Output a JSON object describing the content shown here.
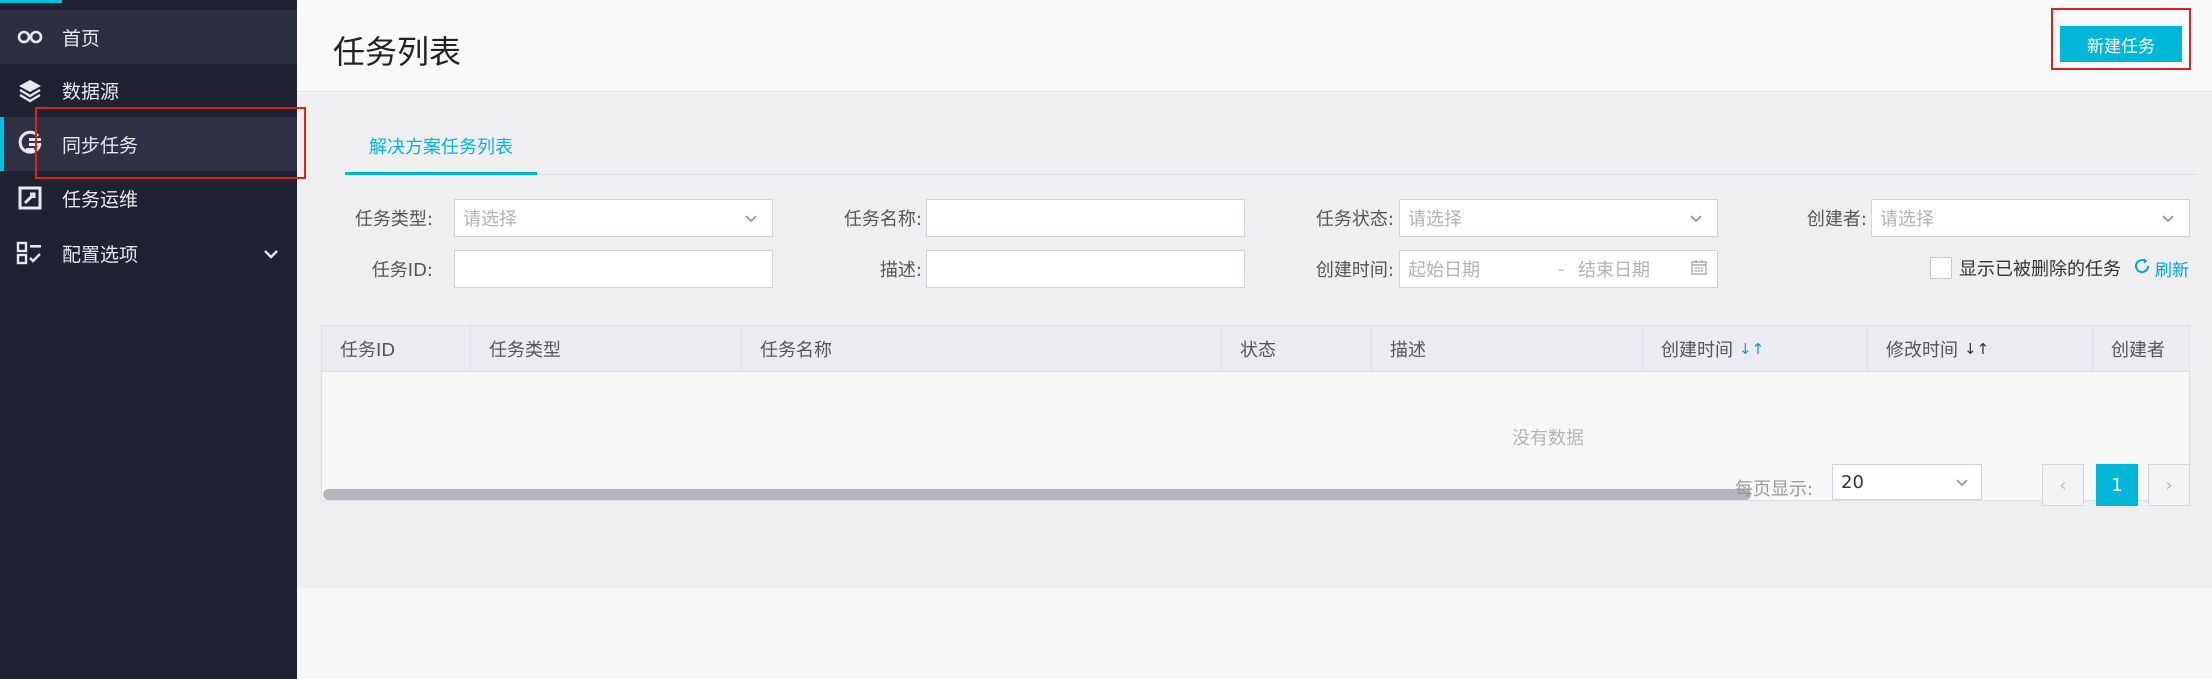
{
  "sidebar": {
    "items": [
      {
        "label": "首页",
        "icon": "infinity-icon"
      },
      {
        "label": "数据源",
        "icon": "layers-icon"
      },
      {
        "label": "同步任务",
        "icon": "sync-task-icon"
      },
      {
        "label": "任务运维",
        "icon": "wrench-box-icon"
      },
      {
        "label": "配置选项",
        "icon": "config-list-icon"
      }
    ]
  },
  "header": {
    "title": "任务列表",
    "new_task": "新建任务"
  },
  "tabs": [
    {
      "label": "解决方案任务列表"
    }
  ],
  "filters": {
    "task_type_label": "任务类型:",
    "task_type_placeholder": "请选择",
    "task_name_label": "任务名称:",
    "task_status_label": "任务状态:",
    "task_status_placeholder": "请选择",
    "creator_label": "创建者:",
    "creator_placeholder": "请选择",
    "task_id_label": "任务ID:",
    "desc_label": "描述:",
    "created_time_label": "创建时间:",
    "start_date_placeholder": "起始日期",
    "date_sep": "-",
    "end_date_placeholder": "结束日期",
    "show_deleted": "显示已被删除的任务",
    "refresh": "刷新"
  },
  "table": {
    "columns": [
      "任务ID",
      "任务类型",
      "任务名称",
      "状态",
      "描述",
      "创建时间",
      "修改时间",
      "创建者"
    ],
    "empty_text": "没有数据"
  },
  "pagination": {
    "page_size_label": "每页显示:",
    "page_size": "20",
    "current_page": "1",
    "prev": "‹",
    "next": "›"
  },
  "colors": {
    "accent": "#00b7d8",
    "sidebar_bg": "#1f2230",
    "annotation": "#e02020"
  }
}
